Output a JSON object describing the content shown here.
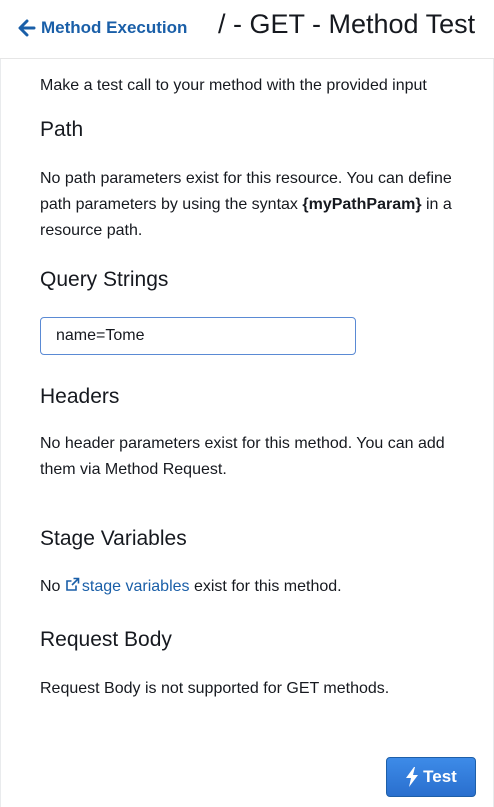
{
  "header": {
    "back_label": "Method Execution",
    "title": "/ - GET - Method Test"
  },
  "intro": "Make a test call to your method with the provided input",
  "path": {
    "heading": "Path",
    "text_before": "No path parameters exist for this resource. You can define path parameters by using the syntax ",
    "syntax": "{myPathParam}",
    "text_after": " in a resource path."
  },
  "query_strings": {
    "heading": "Query Strings",
    "value": "name=Tome"
  },
  "headers": {
    "heading": "Headers",
    "text": "No header parameters exist for this method. You can add them via Method Request."
  },
  "stage_variables": {
    "heading": "Stage Variables",
    "prefix": "No ",
    "link": "stage variables",
    "suffix": " exist for this method."
  },
  "request_body": {
    "heading": "Request Body",
    "text": "Request Body is not supported for GET methods."
  },
  "actions": {
    "test_label": "Test"
  },
  "icons": {
    "back": "arrow-left-icon",
    "external": "external-link-icon",
    "test": "lightning-bolt-icon"
  },
  "colors": {
    "link": "#1a5fa8",
    "primary_button": "#2a6fce",
    "input_border": "#5a8ad4"
  }
}
